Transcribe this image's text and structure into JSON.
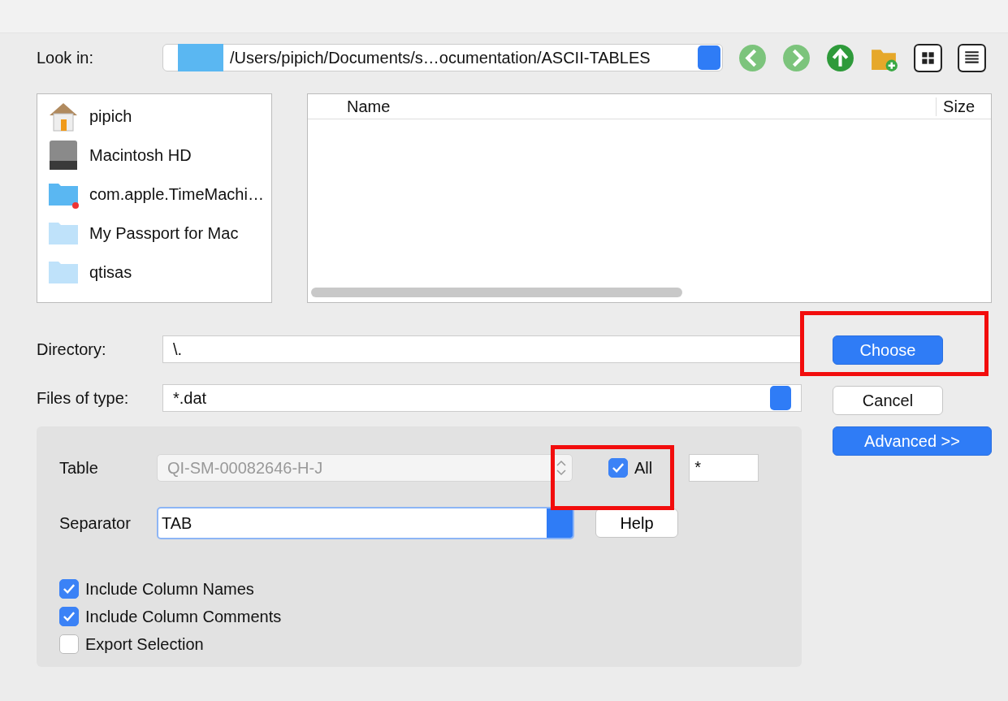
{
  "look_in": {
    "label": "Look in:",
    "path": "/Users/pipich/Documents/s…ocumentation/ASCII-TABLES"
  },
  "nav_buttons": [
    {
      "kind": "back"
    },
    {
      "kind": "forward"
    },
    {
      "kind": "up"
    },
    {
      "kind": "new-folder"
    },
    {
      "kind": "icons"
    },
    {
      "kind": "list"
    }
  ],
  "places": [
    {
      "name": "pipich",
      "kind": "home"
    },
    {
      "name": "Macintosh HD",
      "kind": "disk"
    },
    {
      "name": "com.apple.TimeMachi…",
      "kind": "folder-badge"
    },
    {
      "name": "My Passport for Mac",
      "kind": "folder-pale"
    },
    {
      "name": "qtisas",
      "kind": "folder-pale"
    }
  ],
  "file_list": {
    "columns": [
      "Name",
      "Size"
    ]
  },
  "directory": {
    "label": "Directory:",
    "value": "\\."
  },
  "files_of_type": {
    "label": "Files of type:",
    "value": "*.dat"
  },
  "buttons": [
    {
      "label": "Choose",
      "primary": true
    },
    {
      "label": "Cancel",
      "primary": false
    },
    {
      "label": "Advanced >>",
      "primary": true
    }
  ],
  "table": {
    "label": "Table",
    "value": "QI-SM-00082646-H-J",
    "disabled": true,
    "all": {
      "label": "All",
      "checked": true
    },
    "pattern": "*"
  },
  "separator": {
    "label": "Separator",
    "value": "TAB",
    "help": "Help"
  },
  "options": [
    {
      "label": "Include Column Names",
      "checked": true
    },
    {
      "label": "Include Column Comments",
      "checked": true
    },
    {
      "label": "Export Selection",
      "checked": false
    }
  ]
}
